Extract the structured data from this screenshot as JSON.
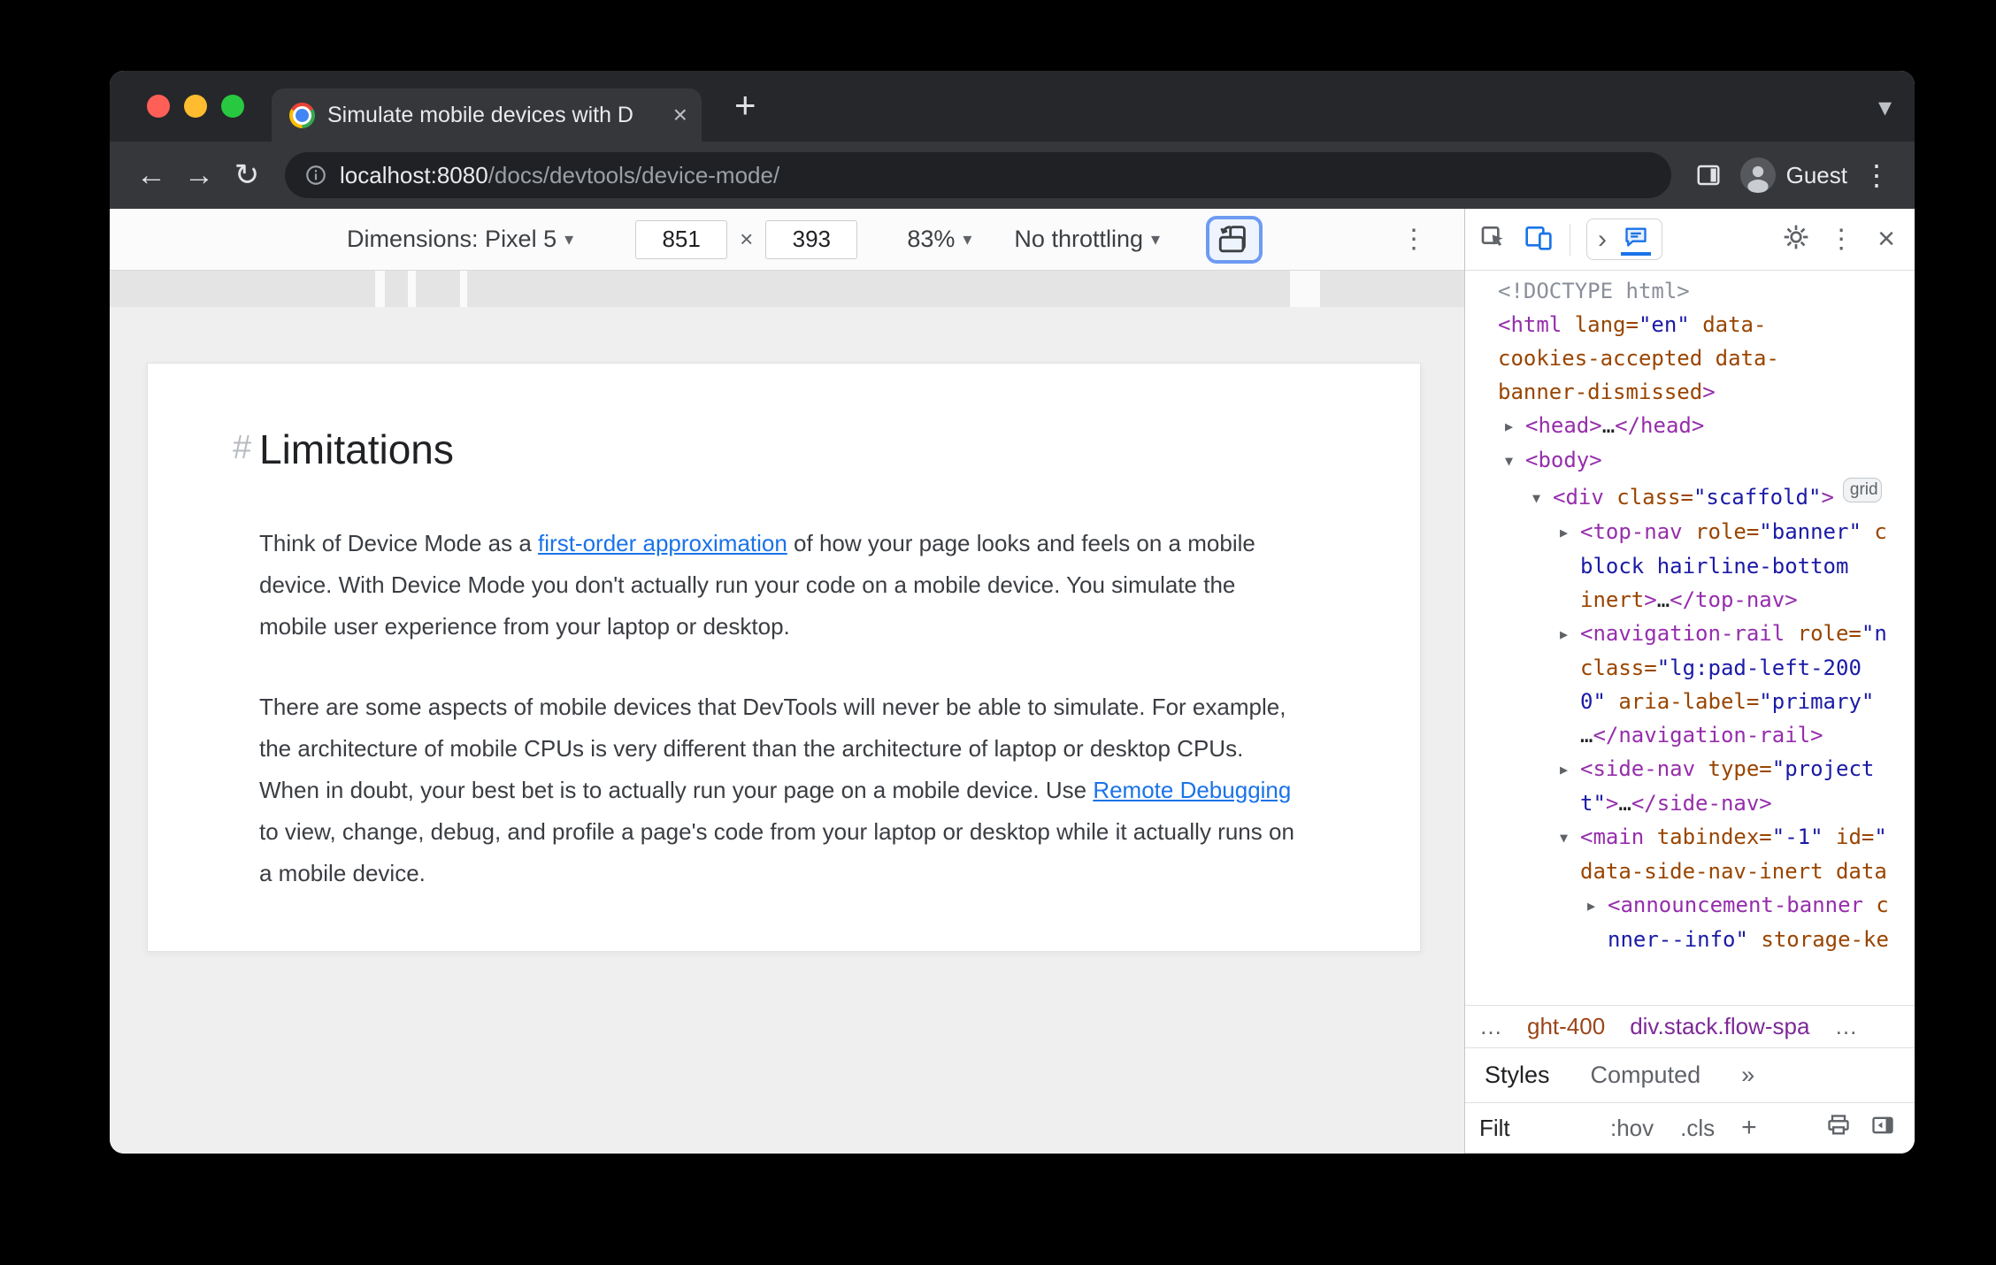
{
  "glyphs": {
    "back": "←",
    "forward": "→",
    "reload": "↻",
    "kebab": "⋮",
    "plus": "+",
    "caret": "▾",
    "chevron_down": "▾",
    "chevron_right": "›",
    "times": "×"
  },
  "chrome": {
    "tab": {
      "title": "Simulate mobile devices with D"
    },
    "address": {
      "host": "localhost:8080",
      "path": "/docs/devtools/device-mode/"
    },
    "guest": "Guest"
  },
  "device_toolbar": {
    "dimensions": "Dimensions: Pixel 5",
    "width": "851",
    "height": "393",
    "zoom": "83%",
    "throttling": "No throttling"
  },
  "page": {
    "heading": {
      "hash": "#",
      "title": "Limitations"
    },
    "paragraph1": {
      "before": "Think of Device Mode as a ",
      "link": "first-order approximation",
      "after": " of how your page looks and feels on a mobile device. With Device Mode you don't actually run your code on a mobile device. You simulate the mobile user experience from your laptop or desktop."
    },
    "paragraph2": {
      "before": "There are some aspects of mobile devices that DevTools will never be able to simulate. For example, the architecture of mobile CPUs is very different than the architecture of laptop or desktop CPUs. When in doubt, your best bet is to actually run your page on a mobile device. Use ",
      "link": "Remote Debugging",
      "after": " to view, change, debug, and profile a page's code from your laptop or desktop while it actually runs on a mobile device."
    }
  },
  "devtools": {
    "dom_lines": [
      {
        "lvl": 0,
        "arrow": null,
        "toks": [
          {
            "c": "d",
            "s": "<!DOCTYPE html>"
          }
        ]
      },
      {
        "lvl": 0,
        "arrow": null,
        "toks": [
          {
            "c": "t",
            "s": "<html"
          },
          {
            "c": "a",
            "s": " lang="
          },
          {
            "c": "v",
            "s": "\"en\""
          },
          {
            "c": "a",
            "s": " data-"
          }
        ]
      },
      {
        "lvl": 0,
        "arrow": null,
        "toks": [
          {
            "c": "a",
            "s": "cookies-accepted data-"
          }
        ]
      },
      {
        "lvl": 0,
        "arrow": null,
        "toks": [
          {
            "c": "a",
            "s": "banner-dismissed"
          },
          {
            "c": "t",
            "s": ">"
          }
        ]
      },
      {
        "lvl": 1,
        "arrow": "closed",
        "toks": [
          {
            "c": "t",
            "s": "<head>"
          },
          {
            "c": "p",
            "s": "…"
          },
          {
            "c": "t",
            "s": "</head>"
          }
        ]
      },
      {
        "lvl": 1,
        "arrow": "open",
        "toks": [
          {
            "c": "t",
            "s": "<body>"
          }
        ]
      },
      {
        "lvl": 2,
        "arrow": "open",
        "toks": [
          {
            "c": "t",
            "s": "<div"
          },
          {
            "c": "a",
            "s": " class="
          },
          {
            "c": "v",
            "s": "\"scaffold\""
          },
          {
            "c": "t",
            "s": ">"
          }
        ],
        "badge": "grid"
      },
      {
        "lvl": 3,
        "arrow": "closed",
        "toks": [
          {
            "c": "t",
            "s": "<top-nav"
          },
          {
            "c": "a",
            "s": " role="
          },
          {
            "c": "v",
            "s": "\"banner\""
          },
          {
            "c": "a",
            "s": " c"
          }
        ]
      },
      {
        "lvl": 3,
        "arrow": null,
        "toks": [
          {
            "c": "v",
            "s": "block hairline-bottom"
          }
        ]
      },
      {
        "lvl": 3,
        "arrow": null,
        "toks": [
          {
            "c": "a",
            "s": "inert"
          },
          {
            "c": "t",
            "s": ">"
          },
          {
            "c": "p",
            "s": "…"
          },
          {
            "c": "t",
            "s": "</top-nav>"
          }
        ]
      },
      {
        "lvl": 3,
        "arrow": "closed",
        "toks": [
          {
            "c": "t",
            "s": "<navigation-rail"
          },
          {
            "c": "a",
            "s": " role="
          },
          {
            "c": "v",
            "s": "\"n"
          }
        ]
      },
      {
        "lvl": 3,
        "arrow": null,
        "toks": [
          {
            "c": "a",
            "s": "class="
          },
          {
            "c": "v",
            "s": "\"lg:pad-left-200 "
          }
        ]
      },
      {
        "lvl": 3,
        "arrow": null,
        "toks": [
          {
            "c": "v",
            "s": "0\""
          },
          {
            "c": "a",
            "s": " aria-label="
          },
          {
            "c": "v",
            "s": "\"primary\""
          }
        ]
      },
      {
        "lvl": 3,
        "arrow": null,
        "toks": [
          {
            "c": "p",
            "s": "…"
          },
          {
            "c": "t",
            "s": "</navigation-rail>"
          }
        ]
      },
      {
        "lvl": 3,
        "arrow": "closed",
        "toks": [
          {
            "c": "t",
            "s": "<side-nav"
          },
          {
            "c": "a",
            "s": " type="
          },
          {
            "c": "v",
            "s": "\"project"
          }
        ]
      },
      {
        "lvl": 3,
        "arrow": null,
        "toks": [
          {
            "c": "v",
            "s": "t\""
          },
          {
            "c": "t",
            "s": ">"
          },
          {
            "c": "p",
            "s": "…"
          },
          {
            "c": "t",
            "s": "</side-nav>"
          }
        ]
      },
      {
        "lvl": 3,
        "arrow": "open",
        "toks": [
          {
            "c": "t",
            "s": "<main"
          },
          {
            "c": "a",
            "s": " tabindex="
          },
          {
            "c": "v",
            "s": "\"-1\""
          },
          {
            "c": "a",
            "s": " id="
          },
          {
            "c": "v",
            "s": "\""
          }
        ]
      },
      {
        "lvl": 3,
        "arrow": null,
        "toks": [
          {
            "c": "a",
            "s": "data-side-nav-inert data"
          }
        ]
      },
      {
        "lvl": 4,
        "arrow": "closed",
        "toks": [
          {
            "c": "t",
            "s": "<announcement-banner"
          },
          {
            "c": "a",
            "s": " c"
          }
        ]
      },
      {
        "lvl": 4,
        "arrow": null,
        "toks": [
          {
            "c": "v",
            "s": "nner--info\""
          },
          {
            "c": "a",
            "s": " storage-ke"
          }
        ]
      }
    ],
    "crumbs": {
      "left_more": "…",
      "crumb_a": "ght-400",
      "crumb_b": "div.stack.flow-spa",
      "right_more": "…"
    },
    "tabs": {
      "styles": "Styles",
      "computed": "Computed",
      "more": "»"
    },
    "filter": {
      "value": "Filt",
      "hov": ":hov",
      "cls": ".cls",
      "plus": "+"
    }
  }
}
